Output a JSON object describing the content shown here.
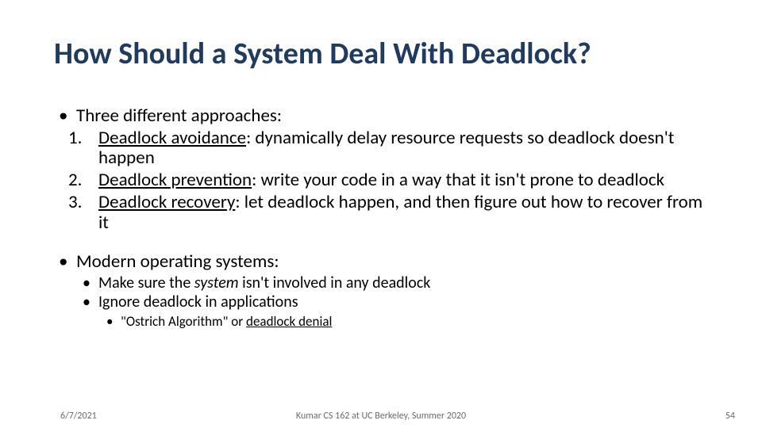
{
  "title": "How Should a System Deal With Deadlock?",
  "intro": "Three different approaches:",
  "items": [
    {
      "num": "1.",
      "term": "Deadlock avoidance",
      "rest": ": dynamically delay resource requests so deadlock doesn't happen"
    },
    {
      "num": "2.",
      "term": "Deadlock prevention",
      "rest": ": write your code in a way that it isn't prone to deadlock"
    },
    {
      "num": "3.",
      "term": "Deadlock recovery",
      "rest": ": let deadlock happen, and then figure out how to recover from it"
    }
  ],
  "modern_heading": "Modern operating systems:",
  "modern_points": [
    {
      "pre": "Make sure the ",
      "em": "system",
      "post": " isn't involved in any deadlock"
    },
    {
      "pre": "Ignore deadlock in applications",
      "em": "",
      "post": ""
    }
  ],
  "ostrich": {
    "pre": "\"Ostrich Algorithm\" or ",
    "u": "deadlock denial"
  },
  "footer": {
    "date": "6/7/2021",
    "center": "Kumar CS 162 at UC Berkeley, Summer 2020",
    "page": "54"
  }
}
